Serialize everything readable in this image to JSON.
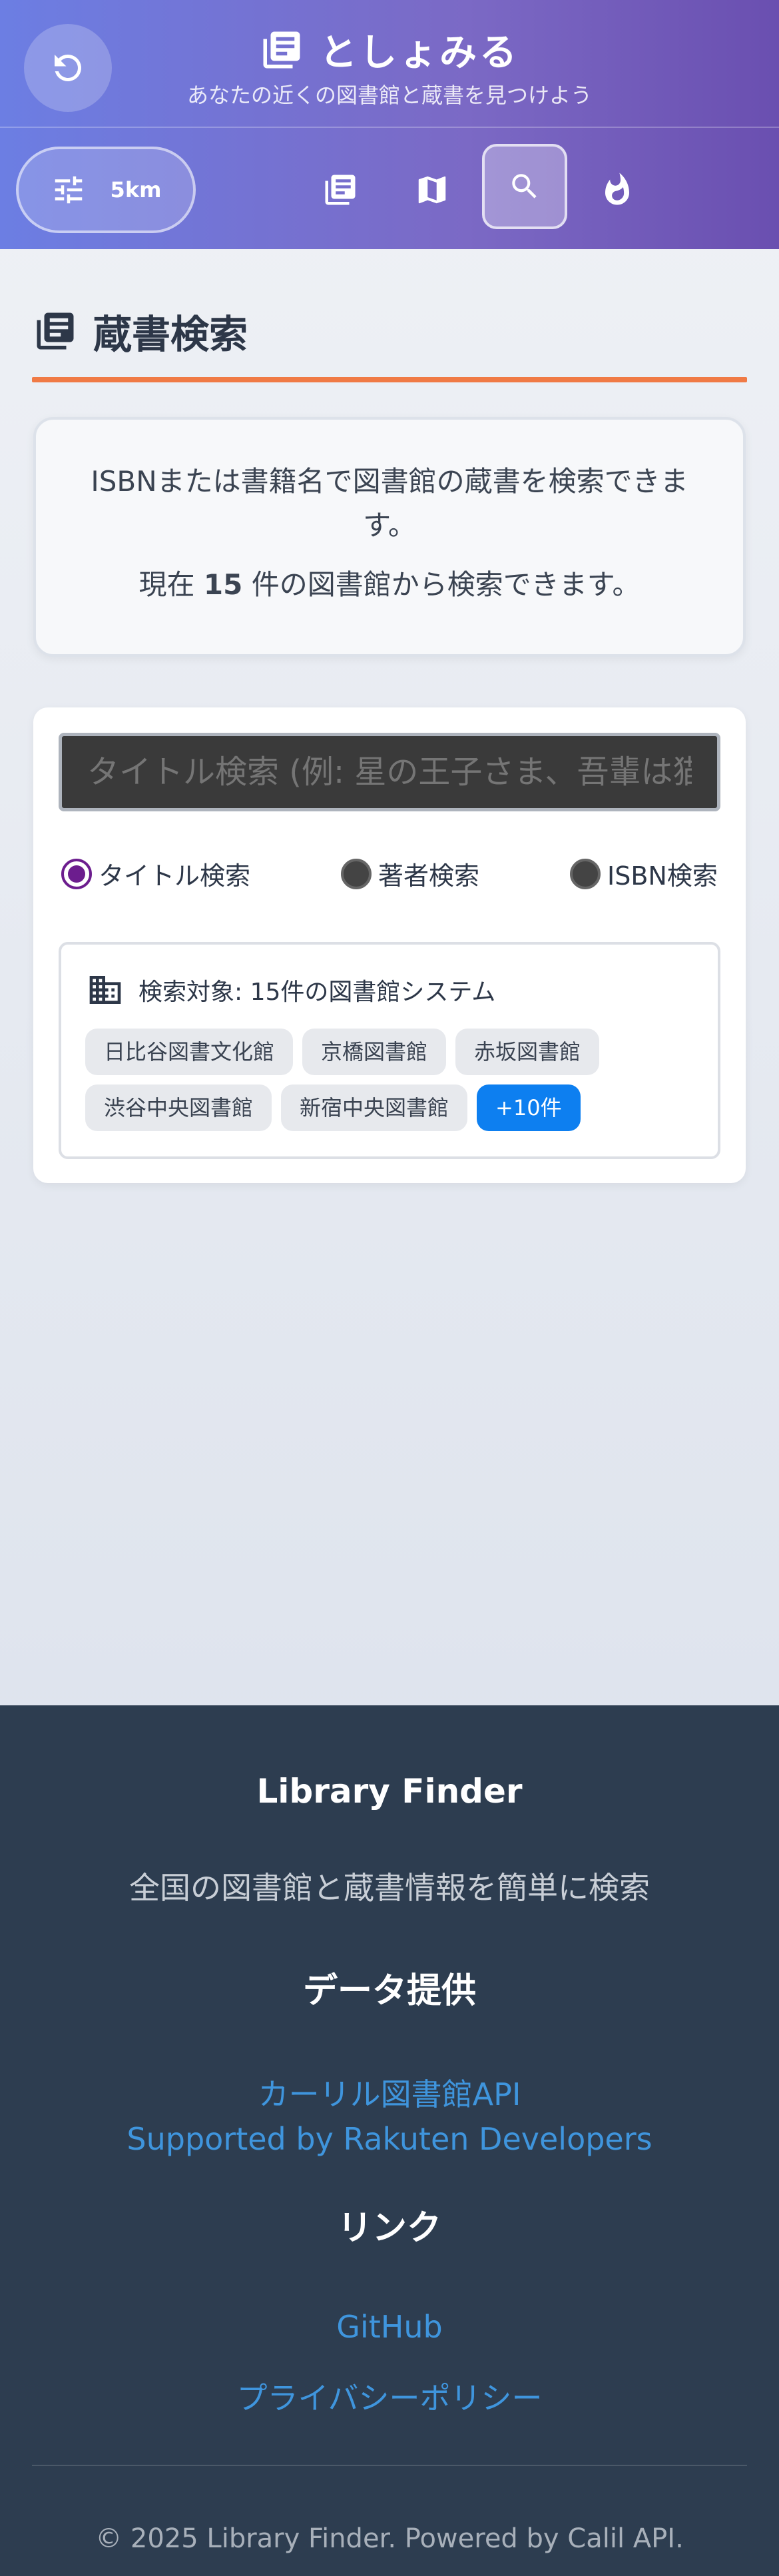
{
  "header": {
    "app_title": "としょみる",
    "subtitle": "あなたの近くの図書館と蔵書を見つけよう",
    "refresh_icon": "refresh-icon",
    "book_icon": "library-books-icon",
    "distance": {
      "label": "5km",
      "icon": "tune-sliders-icon"
    },
    "nav": [
      {
        "name": "library-books-icon",
        "active": false
      },
      {
        "name": "map-icon",
        "active": false
      },
      {
        "name": "search-icon",
        "active": true
      },
      {
        "name": "flame-icon",
        "active": false
      }
    ],
    "colors": {
      "gradient_start": "#6c7ee3",
      "gradient_end": "#6a4fb0"
    }
  },
  "main": {
    "section_title": "蔵書検索",
    "accent_color": "#f07a45",
    "info": {
      "line1": "ISBNまたは書籍名で図書館の蔵書を検索できます。",
      "line2_prefix": "現在",
      "line2_count": "15",
      "line2_suffix": "件の図書館から検索できます。"
    },
    "search": {
      "placeholder": "タイトル検索 (例: 星の王子さま、吾輩は猫",
      "modes": [
        {
          "label": "タイトル検索",
          "checked": true
        },
        {
          "label": "著者検索",
          "checked": false
        },
        {
          "label": "ISBN検索",
          "checked": false
        }
      ],
      "target_label": "検索対象: 15件の図書館システム",
      "libraries": [
        "日比谷図書文化館",
        "京橋図書館",
        "赤坂図書館",
        "渋谷中央図書館",
        "新宿中央図書館"
      ],
      "more_label": "+10件"
    }
  },
  "footer": {
    "brand": "Library Finder",
    "description": "全国の図書館と蔵書情報を簡単に検索",
    "data_heading": "データ提供",
    "data_links": [
      "カーリル図書館API",
      "Supported by Rakuten Developers"
    ],
    "links_heading": "リンク",
    "links": [
      "GitHub",
      "プライバシーポリシー"
    ],
    "copyright": "© 2025 Library Finder. Powered by Calil API.",
    "link_color": "#3f95dd"
  }
}
